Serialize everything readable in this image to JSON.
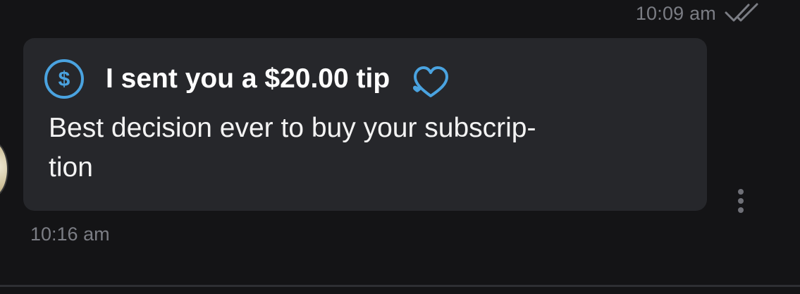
{
  "previous_message": {
    "timestamp": "10:09 am",
    "status_icon": "double-check-icon"
  },
  "message": {
    "tip_icon": "dollar-circle-icon",
    "tip_label": "I sent you a $20.00 tip",
    "decoration_icon": "heart-icon",
    "text": "Best decision ever to buy your subscrip-\ntion",
    "timestamp": "10:16 am",
    "menu_icon": "more-vertical-icon"
  },
  "colors": {
    "background": "#141416",
    "bubble": "#26272b",
    "accent": "#4aa3e0",
    "timestamp": "#7b7d84",
    "text": "#ffffff"
  }
}
